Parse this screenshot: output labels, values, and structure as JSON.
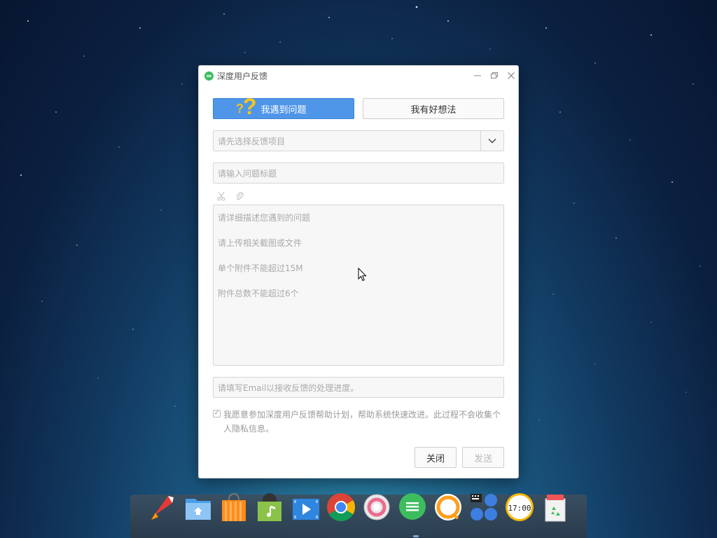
{
  "window": {
    "title": "深度用户反馈"
  },
  "tabs": {
    "problem": "我遇到问题",
    "idea": "我有好想法"
  },
  "form": {
    "project_placeholder": "请先选择反馈项目",
    "title_placeholder": "请输入问题标题",
    "description_hints": [
      "请详细描述您遇到的问题",
      "请上传相关截图或文件",
      "单个附件不能超过15M",
      "附件总数不能超过6个"
    ],
    "email_placeholder": "请填写Email以接收反馈的处理进度。",
    "agreement_text": "我愿意参加深度用户反馈帮助计划，帮助系统快速改进。此过程不会收集个人隐私信息。",
    "agreement_checked": true
  },
  "buttons": {
    "close": "关闭",
    "send": "发送"
  },
  "colors": {
    "accent": "#4f95e8",
    "app_icon": "#3ebd5f"
  },
  "dock": {
    "items": [
      "launcher-icon",
      "file-manager-icon",
      "app-store-icon",
      "music-icon",
      "movie-icon",
      "chrome-icon",
      "settings-icon",
      "feedback-icon",
      "browser-ring-icon",
      "deepin-apps-icon",
      "clock-icon",
      "trash-icon"
    ],
    "clock_text": "17:00"
  }
}
